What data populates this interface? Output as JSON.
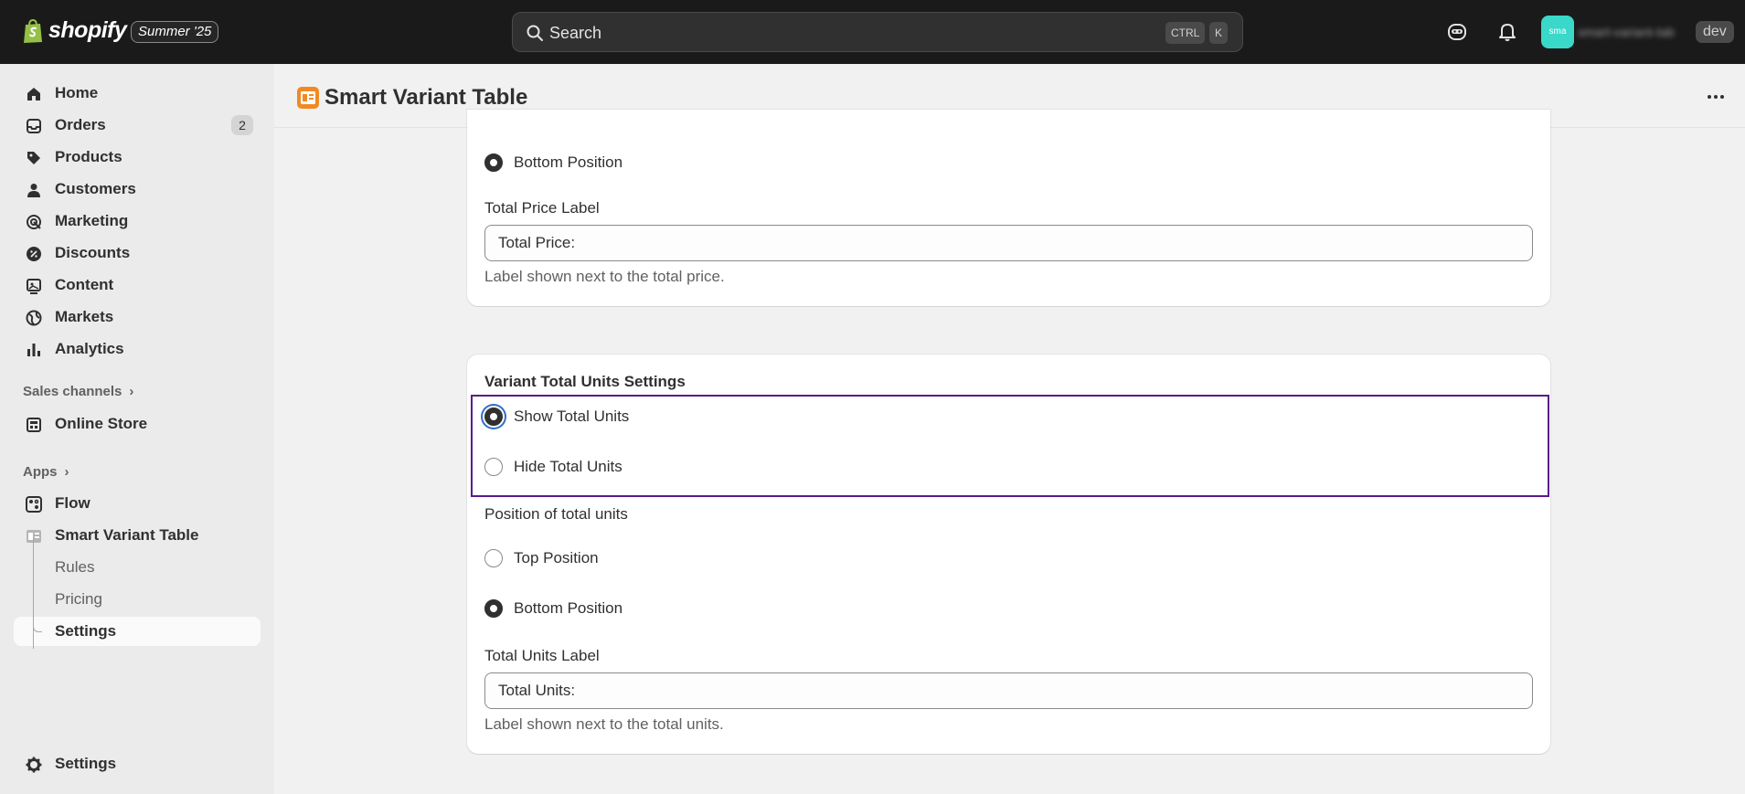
{
  "topbar": {
    "brand": "shopify",
    "edition": "Summer '25",
    "search_placeholder": "Search",
    "shortcut_ctrl": "CTRL",
    "shortcut_k": "K",
    "avatar_initials": "sma",
    "store_name": "smart-variant-tab",
    "dev_badge": "dev"
  },
  "sidebar": {
    "items": [
      {
        "label": "Home",
        "icon": "home-icon"
      },
      {
        "label": "Orders",
        "icon": "inbox-icon",
        "badge": "2"
      },
      {
        "label": "Products",
        "icon": "tag-icon"
      },
      {
        "label": "Customers",
        "icon": "person-icon"
      },
      {
        "label": "Marketing",
        "icon": "target-icon"
      },
      {
        "label": "Discounts",
        "icon": "discount-icon"
      },
      {
        "label": "Content",
        "icon": "content-icon"
      },
      {
        "label": "Markets",
        "icon": "globe-icon"
      },
      {
        "label": "Analytics",
        "icon": "chart-icon"
      }
    ],
    "sales_channels_label": "Sales channels",
    "online_store": "Online Store",
    "apps_label": "Apps",
    "flow": "Flow",
    "app_name": "Smart Variant Table",
    "sub_items": [
      "Rules",
      "Pricing",
      "Settings"
    ],
    "settings": "Settings"
  },
  "page": {
    "title": "Smart Variant Table"
  },
  "card_top": {
    "bottom_position_label": "Bottom Position",
    "total_price_label": "Total Price Label",
    "total_price_value": "Total Price:",
    "total_price_help": "Label shown next to the total price."
  },
  "card_bottom": {
    "title": "Variant Total Units Settings",
    "show_total_units": "Show Total Units",
    "hide_total_units": "Hide Total Units",
    "position_label": "Position of total units",
    "top_position": "Top Position",
    "bottom_position": "Bottom Position",
    "total_units_label": "Total Units Label",
    "total_units_value": "Total Units:",
    "total_units_help": "Label shown next to the total units."
  },
  "colors": {
    "topbar_bg": "#1a1a1a",
    "focus_ring": "#2c6ecb",
    "highlight_border": "#5b1a8a",
    "avatar_bg": "#3ad8c8",
    "app_icon": "#f08a24"
  }
}
